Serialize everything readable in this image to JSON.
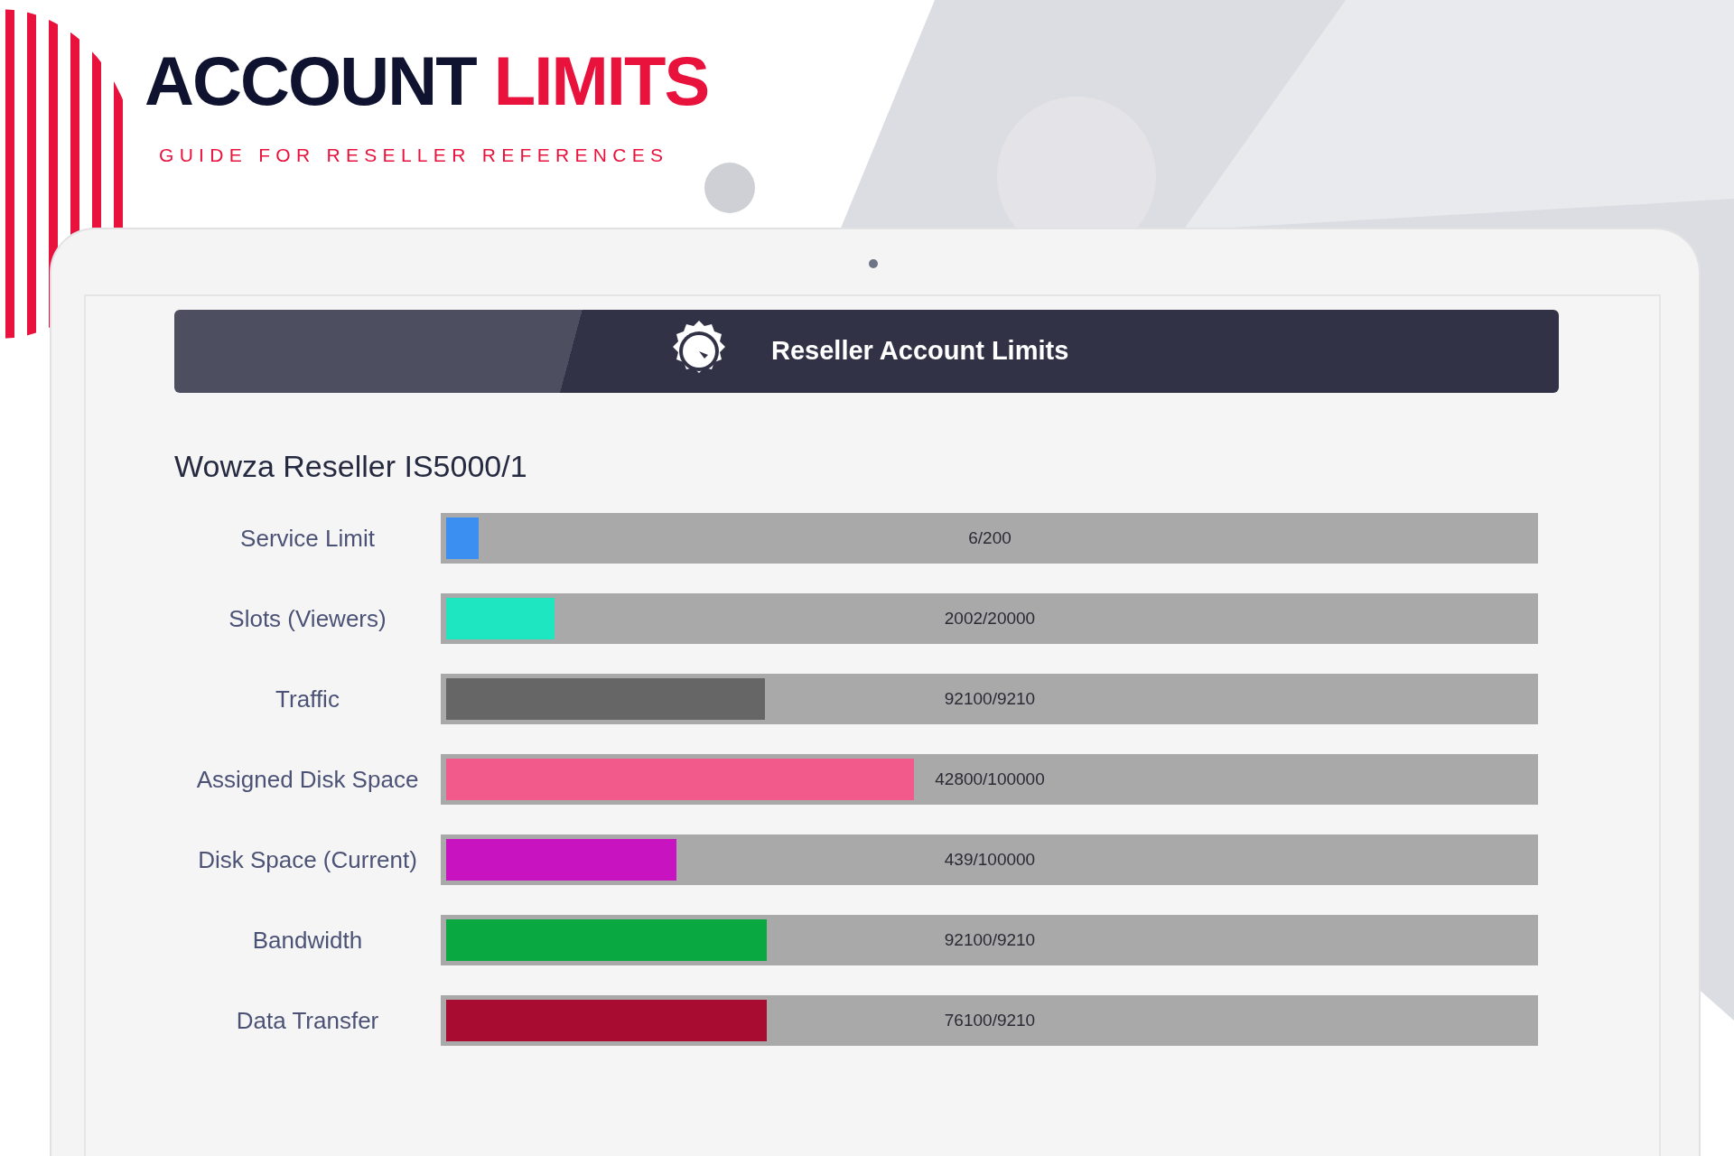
{
  "banner": {
    "title_dark": "ACCOUNT",
    "title_accent": "LIMITS",
    "subtitle": "GUIDE FOR RESELLER REFERENCES"
  },
  "panel": {
    "title": "Reseller Account Limits",
    "heading": "Wowza Reseller IS5000/1"
  },
  "limits": [
    {
      "label": "Service Limit",
      "level": 0.03,
      "reading": "6/200",
      "color": "#3b8ff0"
    },
    {
      "label": "Slots (Viewers)",
      "level": 0.1,
      "reading": "2002/20000",
      "color": "#1de6c0"
    },
    {
      "label": "Traffic",
      "level": 0.293,
      "reading": "92100/9210",
      "color": "#666666"
    },
    {
      "label": "Assigned Disk Space",
      "level": 0.43,
      "reading": "42800/100000",
      "color": "#f25a8c"
    },
    {
      "label": "Disk Space (Current)",
      "level": 0.212,
      "reading": "439/100000",
      "color": "#c814c0"
    },
    {
      "label": "Bandwidth",
      "level": 0.295,
      "reading": "92100/9210",
      "color": "#0aa840"
    },
    {
      "label": "Data Transfer",
      "level": 0.295,
      "reading": "76100/9210",
      "color": "#a80c30"
    }
  ]
}
